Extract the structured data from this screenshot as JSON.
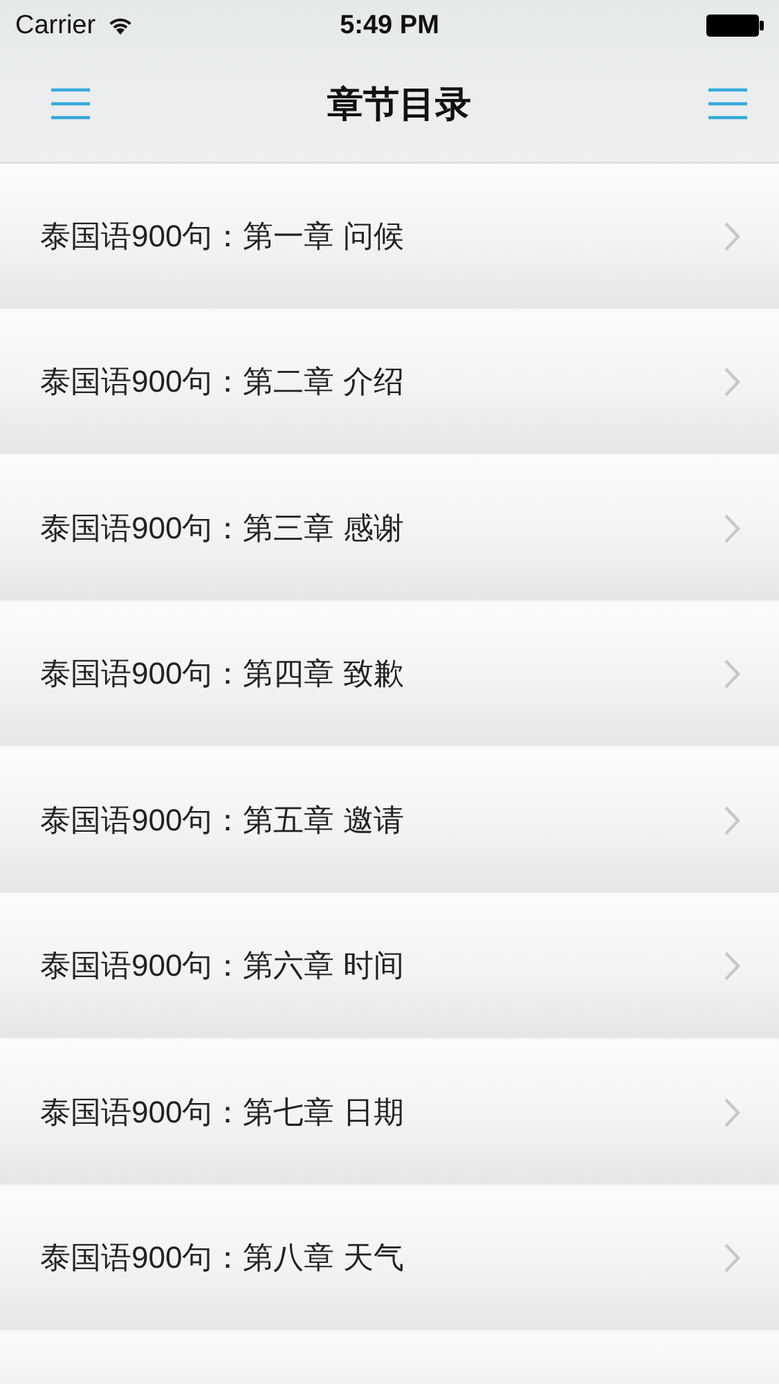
{
  "status_bar": {
    "carrier": "Carrier",
    "time": "5:49 PM"
  },
  "nav_bar": {
    "title": "章节目录"
  },
  "chapters": [
    {
      "label": "泰国语900句：第一章 问候"
    },
    {
      "label": "泰国语900句：第二章 介绍"
    },
    {
      "label": "泰国语900句：第三章 感谢"
    },
    {
      "label": "泰国语900句：第四章 致歉"
    },
    {
      "label": "泰国语900句：第五章 邀请"
    },
    {
      "label": "泰国语900句：第六章 时间"
    },
    {
      "label": "泰国语900句：第七章 日期"
    },
    {
      "label": "泰国语900句：第八章 天气"
    }
  ]
}
